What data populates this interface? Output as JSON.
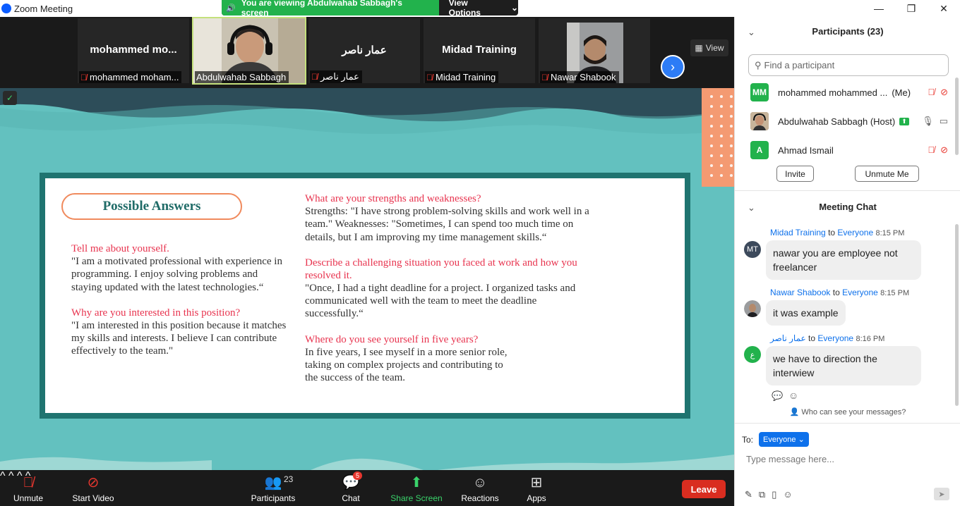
{
  "window": {
    "title": "Zoom Meeting",
    "viewing_banner": "You are viewing Abdulwahab Sabbagh's screen",
    "view_options": "View Options",
    "controls": {
      "minimize": "—",
      "maximize": "❐",
      "close": "✕"
    }
  },
  "strip": {
    "tiles": [
      {
        "big": "mohammed  mo...",
        "small": "mohammed moham...",
        "muted": true
      },
      {
        "big": "",
        "small": "Abdulwahab Sabbagh",
        "muted": false
      },
      {
        "big": "عمار ناصر",
        "small": "عمار ناصر",
        "muted": true
      },
      {
        "big": "Midad Training",
        "small": "Midad Training",
        "muted": true
      },
      {
        "big": "",
        "small": "Nawar Shabook",
        "muted": true
      }
    ],
    "view_label": "View"
  },
  "slide": {
    "heading": "Possible Answers",
    "left": [
      {
        "q": "Tell me about yourself.",
        "a": "\"I am a motivated professional with experience in programming. I enjoy solving problems and staying updated with the latest technologies.“"
      },
      {
        "q": "Why are you interested in this position?",
        "a": "\"I am interested in this position because it matches my skills and interests. I believe I can contribute effectively to the team.\""
      }
    ],
    "right": [
      {
        "q": "What are your strengths and weaknesses?",
        "a": "Strengths: \"I have strong problem-solving skills and work well in a team.\" Weaknesses: \"Sometimes, I can spend too much time on details, but I am improving my time management skills.“"
      },
      {
        "q": "Describe a challenging situation you faced at work and how you resolved it.",
        "a": "\"Once, I had a tight deadline for a project. I organized tasks and communicated well with the team to meet the deadline successfully.“"
      },
      {
        "q": "Where do you see yourself in five years?",
        "a": "In five years, I see myself in a more senior role, taking on complex projects and contributing to the success of the team."
      }
    ]
  },
  "toolbar": {
    "unmute": "Unmute",
    "start_video": "Start Video",
    "participants": "Participants",
    "participants_count": "23",
    "chat": "Chat",
    "chat_badge": "5",
    "share_screen": "Share Screen",
    "reactions": "Reactions",
    "apps": "Apps",
    "leave": "Leave"
  },
  "participants": {
    "title": "Participants (23)",
    "search_placeholder": "Find a participant",
    "list": [
      {
        "initials": "MM",
        "name": "mohammed mohammed ...",
        "suffix": "(Me)",
        "color": "#22b24c"
      },
      {
        "initials": "",
        "name": "Abdulwahab Sabbagh (Host)",
        "suffix": "",
        "color": "#8a6a4a"
      },
      {
        "initials": "A",
        "name": "Ahmad Ismail",
        "suffix": "",
        "color": "#22b24c"
      }
    ],
    "invite": "Invite",
    "unmute_me": "Unmute Me"
  },
  "chat": {
    "title": "Meeting Chat",
    "messages": [
      {
        "sender": "Midad Training",
        "to": "to",
        "target": "Everyone",
        "time": "8:15 PM",
        "text": "nawar you are employee not freelancer",
        "avatar": "MT"
      },
      {
        "sender": "Nawar Shabook",
        "to": "to",
        "target": "Everyone",
        "time": "8:15 PM",
        "text": "it was example",
        "avatar": ""
      },
      {
        "sender": "عمار ناصر",
        "to": "to",
        "target": "Everyone",
        "time": "8:16 PM",
        "text": "we have to direction the interwiew",
        "avatar": "ع"
      }
    ],
    "who_can_see": "Who can see your messages?",
    "to_label": "To:",
    "recipient": "Everyone",
    "input_placeholder": "Type message here..."
  },
  "colors": {
    "accent": "#0e71eb",
    "slide_bg": "#63c1bf",
    "card_border": "#1f7470",
    "question": "#e8344f",
    "leave": "#d92d20"
  }
}
